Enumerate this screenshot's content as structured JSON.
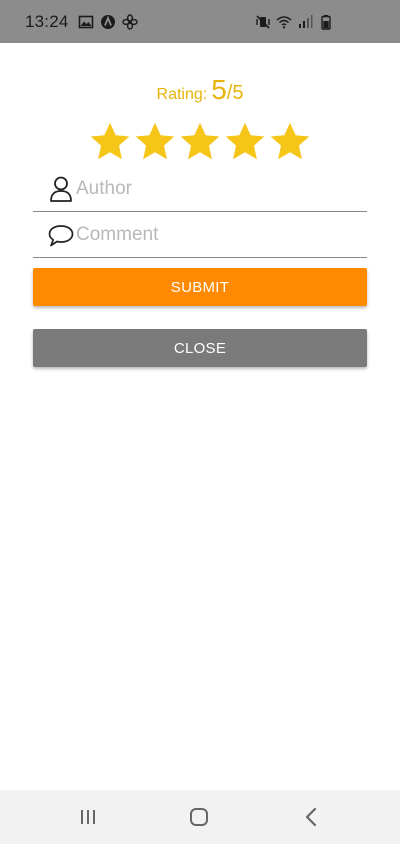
{
  "status_bar": {
    "time": "13:24",
    "left_icons": [
      "image-icon",
      "app-a-icon",
      "fan-icon"
    ],
    "right_icons": [
      "mute-vibrate-icon",
      "wifi-icon",
      "signal-icon",
      "battery-icon"
    ],
    "background": "#8c8c8c"
  },
  "rating": {
    "label": "Rating:",
    "value": "5",
    "separator": "/",
    "max": "5",
    "stars_filled": 5,
    "stars_total": 5,
    "color": "#e8b40a",
    "star_color": "#f5c518"
  },
  "form": {
    "author_placeholder": "Author",
    "author_value": "",
    "comment_placeholder": "Comment",
    "comment_value": "",
    "author_icon": "user-icon",
    "comment_icon": "speech-bubble-icon"
  },
  "buttons": {
    "submit_label": "SUBMIT",
    "submit_color": "#ff8a00",
    "close_label": "CLOSE",
    "close_color": "#7a7a7a"
  },
  "nav_bar": {
    "buttons": [
      "recent-apps-icon",
      "home-icon",
      "back-icon"
    ]
  }
}
